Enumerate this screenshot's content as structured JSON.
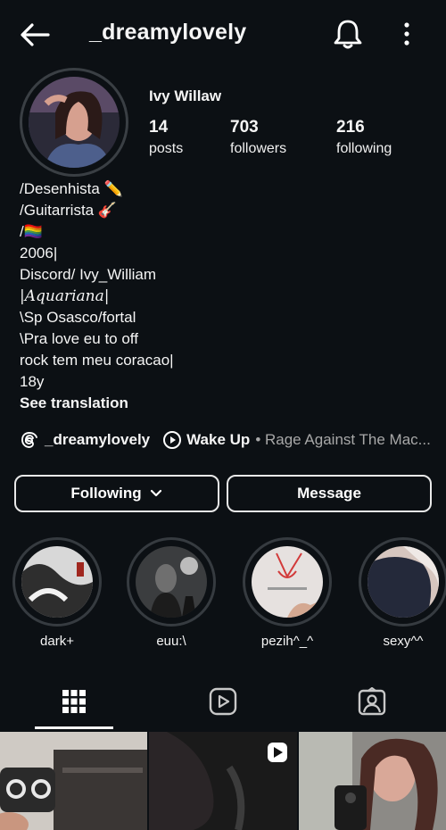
{
  "header": {
    "username": "_dreamylovely",
    "icons": {
      "back": "back-arrow-icon",
      "bell": "bell-icon",
      "more": "more-vertical-icon"
    }
  },
  "profile": {
    "full_name": "Ivy Willaw",
    "stats": [
      {
        "value": "14",
        "label": "posts"
      },
      {
        "value": "703",
        "label": "followers"
      },
      {
        "value": "216",
        "label": "following"
      }
    ],
    "bio": [
      "/Desenhista ✏️",
      "/Guitarrista 🎸",
      "/🏳️‍🌈",
      "2006|",
      "Discord/ Ivy_William",
      "|Aquariana|",
      "\\Sp Osasco/fortal",
      "\\Pra love eu to off",
      "rock tem meu coracao|",
      "18y"
    ],
    "see_translation": "See translation"
  },
  "links": {
    "threads_handle": "_dreamylovely",
    "song_title": "Wake Up",
    "song_artist": "• Rage Against The Mac..."
  },
  "actions": {
    "following": "Following",
    "message": "Message"
  },
  "highlights": [
    {
      "label": "dark+"
    },
    {
      "label": "euu:\\"
    },
    {
      "label": "pezih^_^"
    },
    {
      "label": "sexy^^"
    }
  ],
  "tabs": {
    "active": "grid-tab"
  },
  "colors": {
    "background": "#0c1014",
    "text": "#f5f5f5",
    "muted": "#a8a8a8"
  }
}
